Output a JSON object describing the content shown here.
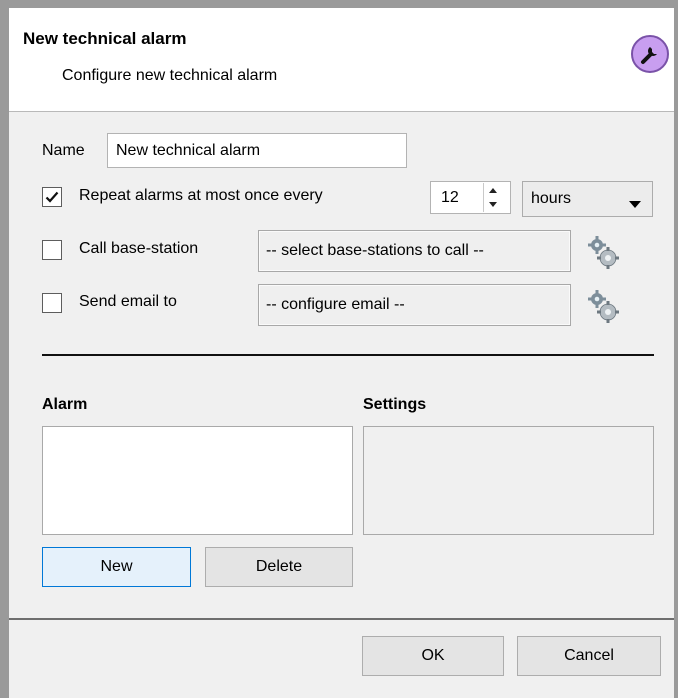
{
  "dialog": {
    "title": "New technical alarm",
    "subtitle": "Configure new technical alarm",
    "header_icon": "wrench-icon"
  },
  "form": {
    "name_label": "Name",
    "name_value": "New technical alarm",
    "repeat": {
      "checked": true,
      "label": "Repeat alarms at most once every",
      "value": "12",
      "unit": "hours"
    },
    "call_base_station": {
      "checked": false,
      "label": "Call base-station",
      "select_text": "-- select base-stations to call --",
      "icon": "gear-icon"
    },
    "send_email": {
      "checked": false,
      "label": "Send email to",
      "select_text": "-- configure email --",
      "icon": "gear-icon"
    }
  },
  "alarm_section": {
    "alarm_title": "Alarm",
    "settings_title": "Settings",
    "new_button": "New",
    "delete_button": "Delete"
  },
  "footer": {
    "ok_button": "OK",
    "cancel_button": "Cancel"
  },
  "colors": {
    "accent": "#0078d7",
    "icon_purple": "#c89ef0"
  }
}
